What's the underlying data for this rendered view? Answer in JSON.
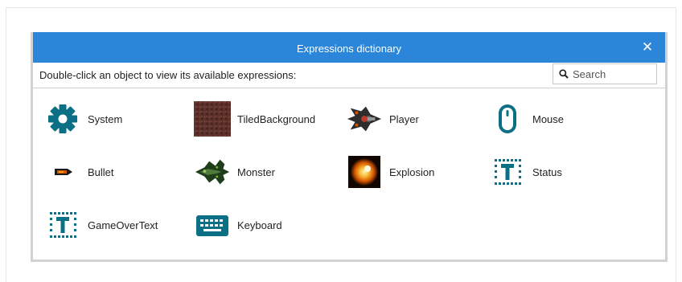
{
  "dialog": {
    "title": "Expressions dictionary",
    "close_label": "✕",
    "instruction": "Double-click an object to view its available expressions:",
    "search_placeholder": "Search"
  },
  "objects": [
    {
      "label": "System",
      "icon": "gear-icon"
    },
    {
      "label": "TiledBackground",
      "icon": "tiled-background-icon"
    },
    {
      "label": "Player",
      "icon": "player-ship-icon"
    },
    {
      "label": "Mouse",
      "icon": "mouse-icon"
    },
    {
      "label": "Bullet",
      "icon": "bullet-icon"
    },
    {
      "label": "Monster",
      "icon": "monster-icon"
    },
    {
      "label": "Explosion",
      "icon": "explosion-icon"
    },
    {
      "label": "Status",
      "icon": "text-object-icon"
    },
    {
      "label": "GameOverText",
      "icon": "text-object-icon"
    },
    {
      "label": "Keyboard",
      "icon": "keyboard-icon"
    }
  ],
  "colors": {
    "titlebar": "#2b86d9",
    "icon_teal": "#0b6f86"
  }
}
